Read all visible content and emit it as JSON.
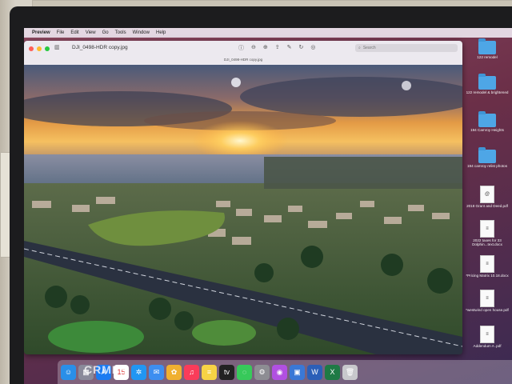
{
  "menubar": {
    "app": "Preview",
    "items": [
      "File",
      "Edit",
      "View",
      "Go",
      "Tools",
      "Window",
      "Help"
    ]
  },
  "window": {
    "title": "DJI_0498-HDR copy.jpg",
    "subtitle": "DJI_0498-HDR copy.jpg",
    "search_placeholder": "Search"
  },
  "desktop_icons": [
    {
      "label": "122 remodel",
      "kind": "folder"
    },
    {
      "label": "122 remodel & brightened",
      "kind": "folder"
    },
    {
      "label": "194 Camroy Heights",
      "kind": "folder"
    },
    {
      "label": "194 camroy relist photos",
      "kind": "folder"
    },
    {
      "label": "2018 Grant and Deed.pdf",
      "kind": "document"
    },
    {
      "label": "2022 taxes for 33 Dolphin...text.docx",
      "kind": "document"
    },
    {
      "label": "*Pricing Matrix 10.18.docx",
      "kind": "document"
    },
    {
      "label": "*westwind open house.pdf",
      "kind": "document"
    },
    {
      "label": "Addendum A .pdf",
      "kind": "document"
    }
  ],
  "watermark": "CRMLS",
  "colors": {
    "close": "#ff5f57",
    "minimize": "#febc2e",
    "zoom": "#28c840",
    "folder": "#4ea6e6"
  },
  "dock_apps": [
    {
      "name": "finder-icon",
      "glyph": "☺",
      "color": "#2a8fe8"
    },
    {
      "name": "launchpad-icon",
      "glyph": "▦",
      "color": "#8a8a9a"
    },
    {
      "name": "app-store-icon",
      "glyph": "A",
      "color": "#1c7cf2"
    },
    {
      "name": "calendar-icon",
      "glyph": "15",
      "color": "#ffffff"
    },
    {
      "name": "safari-icon",
      "glyph": "✲",
      "color": "#2196f3"
    },
    {
      "name": "mail-icon",
      "glyph": "✉",
      "color": "#3d8ef0"
    },
    {
      "name": "photos-icon",
      "glyph": "✿",
      "color": "#f0b030"
    },
    {
      "name": "music-icon",
      "glyph": "♫",
      "color": "#fa3c5a"
    },
    {
      "name": "notes-icon",
      "glyph": "≡",
      "color": "#f7d245"
    },
    {
      "name": "apple-tv-icon",
      "glyph": "tv",
      "color": "#222222"
    },
    {
      "name": "messages-icon",
      "glyph": "◌",
      "color": "#37c95a"
    },
    {
      "name": "system-settings-icon",
      "glyph": "⚙",
      "color": "#8d8d93"
    },
    {
      "name": "podcasts-icon",
      "glyph": "◉",
      "color": "#b150e2"
    },
    {
      "name": "preview-icon",
      "glyph": "▣",
      "color": "#3a78d6"
    },
    {
      "name": "word-icon",
      "glyph": "W",
      "color": "#2b5fb8"
    },
    {
      "name": "excel-icon",
      "glyph": "X",
      "color": "#1e7a45"
    },
    {
      "name": "trash-icon",
      "glyph": "🗑",
      "color": "#c8c8cc"
    }
  ]
}
